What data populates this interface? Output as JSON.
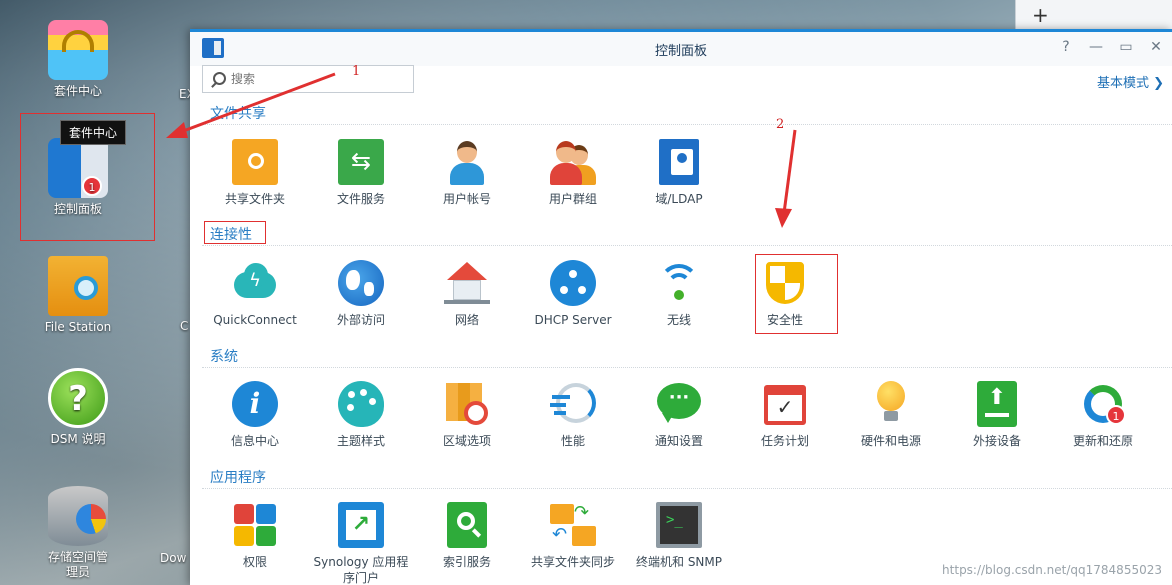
{
  "desktop": {
    "icons": [
      {
        "label": "套件中心"
      },
      {
        "label": "控制面板",
        "badge": "1"
      },
      {
        "label": "File Station"
      },
      {
        "label": "DSM 说明"
      },
      {
        "label": "存储空间管理员"
      }
    ],
    "tooltip": "套件中心",
    "partial_labels": [
      "EX",
      "C",
      "Dow"
    ]
  },
  "tab_strip": {
    "add_label": "+"
  },
  "window": {
    "title": "控制面板",
    "controls": {
      "help": "?",
      "minimize": "—",
      "maximize": "▭",
      "close": "✕"
    },
    "search_placeholder": "搜索",
    "basic_mode_label": "基本模式 ❯",
    "sections": [
      {
        "title": "文件共享",
        "items": [
          {
            "label": "共享文件夹",
            "icon": "shared-folder-icon"
          },
          {
            "label": "文件服务",
            "icon": "file-services-icon"
          },
          {
            "label": "用户帐号",
            "icon": "user-account-icon"
          },
          {
            "label": "用户群组",
            "icon": "user-group-icon"
          },
          {
            "label": "域/LDAP",
            "icon": "domain-ldap-icon"
          }
        ]
      },
      {
        "title": "连接性",
        "items": [
          {
            "label": "QuickConnect",
            "icon": "quickconnect-icon"
          },
          {
            "label": "外部访问",
            "icon": "external-access-icon"
          },
          {
            "label": "网络",
            "icon": "network-icon"
          },
          {
            "label": "DHCP Server",
            "icon": "dhcp-server-icon"
          },
          {
            "label": "无线",
            "icon": "wireless-icon"
          },
          {
            "label": "安全性",
            "icon": "security-icon"
          }
        ]
      },
      {
        "title": "系统",
        "items": [
          {
            "label": "信息中心",
            "icon": "info-center-icon"
          },
          {
            "label": "主题样式",
            "icon": "theme-icon"
          },
          {
            "label": "区域选项",
            "icon": "regional-options-icon"
          },
          {
            "label": "性能",
            "icon": "performance-icon"
          },
          {
            "label": "通知设置",
            "icon": "notification-icon"
          },
          {
            "label": "任务计划",
            "icon": "task-scheduler-icon"
          },
          {
            "label": "硬件和电源",
            "icon": "hardware-power-icon"
          },
          {
            "label": "外接设备",
            "icon": "external-devices-icon"
          },
          {
            "label": "更新和还原",
            "icon": "update-restore-icon",
            "badge": "1"
          }
        ]
      },
      {
        "title": "应用程序",
        "items": [
          {
            "label": "权限",
            "icon": "privileges-icon"
          },
          {
            "label": "Synology 应用程序门户",
            "icon": "app-portal-icon"
          },
          {
            "label": "索引服务",
            "icon": "indexing-service-icon"
          },
          {
            "label": "共享文件夹同步",
            "icon": "shared-folder-sync-icon"
          },
          {
            "label": "终端机和 SNMP",
            "icon": "terminal-snmp-icon"
          }
        ]
      }
    ]
  },
  "annotations": {
    "step1": "1",
    "step2": "2"
  },
  "watermark": "https://blog.csdn.net/qq1784855023",
  "colors": {
    "accent": "#1e87d6",
    "section_title": "#2a7ec4",
    "annotation_red": "#d02020"
  }
}
